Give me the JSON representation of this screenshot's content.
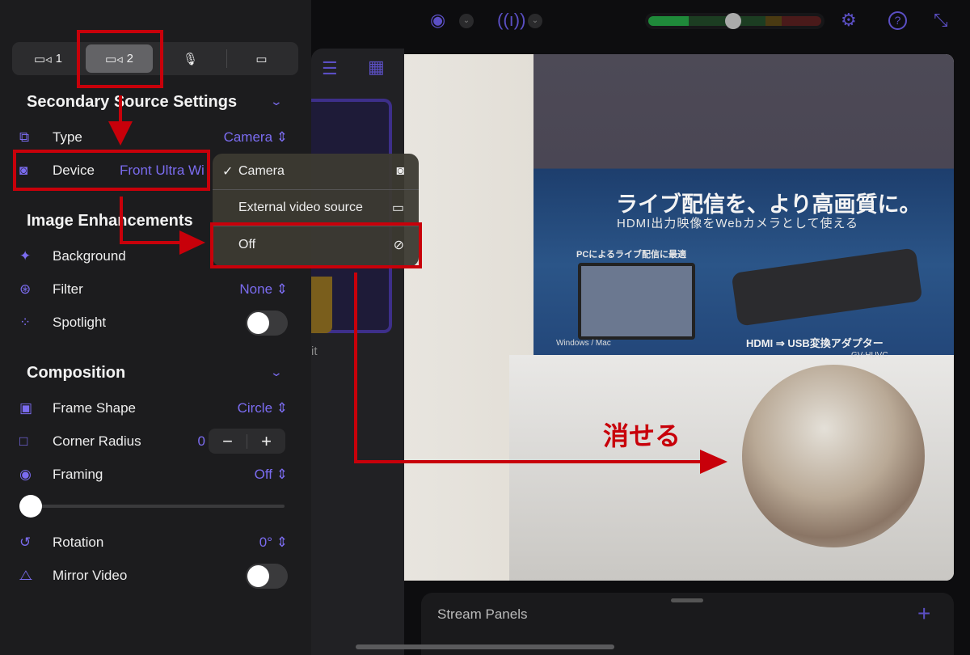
{
  "source_tabs": [
    {
      "icon": "video-camera-icon",
      "label": "1"
    },
    {
      "icon": "video-camera-icon",
      "label": "2",
      "selected": true
    },
    {
      "icon": "microphone-icon",
      "label": ""
    },
    {
      "icon": "screen-share-icon",
      "label": ""
    }
  ],
  "secondary": {
    "title": "Secondary Source Settings",
    "type_label": "Type",
    "type_value": "Camera",
    "device_label": "Device",
    "device_value": "Front Ultra Wi"
  },
  "enhancements": {
    "title": "Image Enhancements",
    "background_label": "Background",
    "filter_label": "Filter",
    "filter_value": "None",
    "spotlight_label": "Spotlight",
    "spotlight_on": false
  },
  "composition": {
    "title": "Composition",
    "frame_shape_label": "Frame Shape",
    "frame_shape_value": "Circle",
    "corner_radius_label": "Corner Radius",
    "corner_radius_value": "0",
    "minus": "−",
    "plus": "+",
    "framing_label": "Framing",
    "framing_value": "Off",
    "framing_slider": 0,
    "rotation_label": "Rotation",
    "rotation_value": "0°",
    "mirror_label": "Mirror Video",
    "mirror_on": false
  },
  "dropdown": {
    "items": [
      {
        "label": "Camera",
        "checked": true,
        "icon": "camera-icon"
      },
      {
        "label": "External video source",
        "icon": "monitor-icon"
      },
      {
        "label": "Off",
        "icon": "eye-slash-icon"
      }
    ]
  },
  "audio_meter": {
    "level": 0.48,
    "colors": [
      "#1f8a3a",
      "#1c3d22",
      "#4a3a12",
      "#4a1a1a"
    ]
  },
  "accent": "#7b6cf0",
  "annotation": {
    "text": "消せる",
    "color": "#c8000a"
  },
  "video_text": {
    "headline": "ライブ配信を、より高画質に。",
    "sub": "HDMI出力映像をWebカメラとして使える",
    "pc": "PCによるライブ配信に最適",
    "os": "Windows / Mac",
    "product": "HDMI ⇒ USB変換アダプター",
    "model": "GV-HUVC"
  },
  "partial_label": "it",
  "stream_panels": {
    "title": "Stream Panels",
    "add": "+"
  }
}
